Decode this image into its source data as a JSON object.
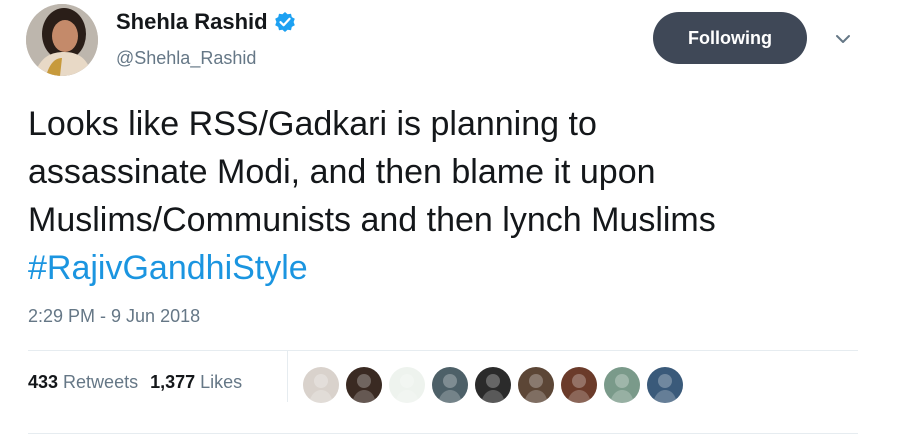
{
  "author": {
    "display_name": "Shehla Rashid",
    "handle": "@Shehla_Rashid"
  },
  "follow_button": {
    "label": "Following"
  },
  "tweet": {
    "text_lines": [
      "Looks like RSS/Gadkari is planning to",
      "assassinate Modi, and then blame it upon",
      "Muslims/Communists and then lynch Muslims"
    ],
    "hashtag": "#RajivGandhiStyle",
    "timestamp": "2:29 PM - 9 Jun 2018"
  },
  "stats": {
    "retweets_count": "433",
    "retweets_label": "Retweets",
    "likes_count": "1,377",
    "likes_label": "Likes"
  },
  "likers": [
    {
      "name": "liker-1",
      "color": "#d9d2cc"
    },
    {
      "name": "liker-2",
      "color": "#3a2a22"
    },
    {
      "name": "liker-3",
      "color": "#eef3ee"
    },
    {
      "name": "liker-4",
      "color": "#4d6068"
    },
    {
      "name": "liker-5",
      "color": "#2b2b2b"
    },
    {
      "name": "liker-6",
      "color": "#5c4636"
    },
    {
      "name": "liker-7",
      "color": "#6b3b2a"
    },
    {
      "name": "liker-8",
      "color": "#7a9a8a"
    },
    {
      "name": "liker-9",
      "color": "#3a5a7a"
    }
  ],
  "colors": {
    "accent": "#1b95e0",
    "button_bg": "#3f4857",
    "secondary_text": "#657786",
    "verified": "#1da1f2"
  },
  "icons": {
    "verified": "verified-badge-icon",
    "caret": "chevron-down-icon"
  }
}
